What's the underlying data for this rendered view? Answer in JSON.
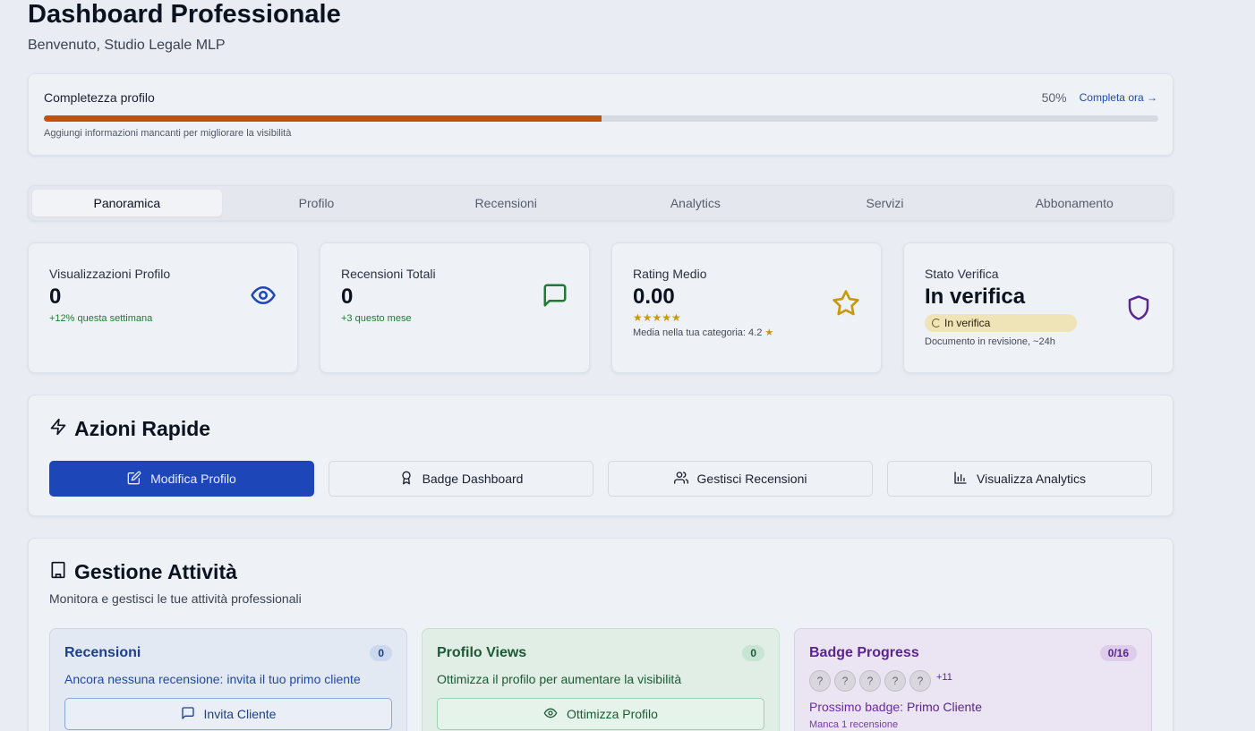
{
  "header": {
    "title": "Dashboard Professionale",
    "subtitle": "Benvenuto, Studio Legale MLP"
  },
  "completeness": {
    "label": "Completezza profilo",
    "percent_text": "50%",
    "percent": 50,
    "link": "Completa ora →",
    "hint": "Aggiungi informazioni mancanti per migliorare la visibilità",
    "fill_color": "#c2500e"
  },
  "tabs": [
    "Panoramica",
    "Profilo",
    "Recensioni",
    "Analytics",
    "Servizi",
    "Abbonamento"
  ],
  "active_tab": "Panoramica",
  "stats": {
    "views": {
      "label": "Visualizzazioni Profilo",
      "value": "0",
      "sub": "+12% questa settimana",
      "icon": "eye-icon"
    },
    "reviews": {
      "label": "Recensioni Totali",
      "value": "0",
      "sub": "+3 questo mese",
      "icon": "message-square-icon"
    },
    "rating": {
      "label": "Rating Medio",
      "value": "0.00",
      "stars": "★★★★★",
      "sub": "Media nella tua categoria: 4.2",
      "icon": "star-icon"
    },
    "verify": {
      "label": "Stato Verifica",
      "value": "In verifica",
      "badge": "In verifica",
      "sub": "Documento in revisione, ~24h",
      "icon": "shield-icon"
    }
  },
  "quick_actions": {
    "title": "Azioni Rapide",
    "buttons": {
      "edit": "Modifica Profilo",
      "badge": "Badge Dashboard",
      "reviews": "Gestisci Recensioni",
      "analytics": "Visualizza Analytics"
    }
  },
  "gestione": {
    "title": "Gestione Attività",
    "subtitle": "Monitora e gestisci le tue attività professionali",
    "reviews_card": {
      "title": "Recensioni",
      "count": "0",
      "text": "Ancora nessuna recensione: invita il tuo primo cliente",
      "button": "Invita Cliente"
    },
    "views_card": {
      "title": "Profilo Views",
      "count": "0",
      "text": "Ottimizza il profilo per aumentare la visibilità",
      "button": "Ottimizza Profilo"
    },
    "badge_card": {
      "title": "Badge Progress",
      "count": "0/16",
      "circle": "?",
      "more": "+11",
      "next_label": "Prossimo badge:",
      "next_name": "Primo Cliente",
      "missing": "Manca 1 recensione"
    }
  },
  "colors": {
    "primary": "#1d46b8",
    "success": "#1f7a35",
    "warning": "#c9980d",
    "purple": "#5a2590",
    "progress": "#c2500e"
  }
}
